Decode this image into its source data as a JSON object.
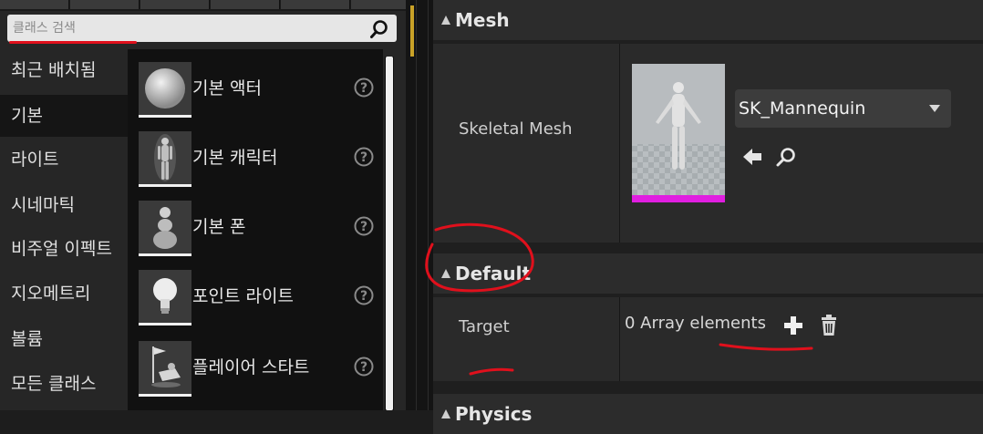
{
  "placement": {
    "search": {
      "placeholder": "클래스 검색",
      "value": ""
    },
    "categories": [
      {
        "label": "최근 배치됨",
        "selected": false
      },
      {
        "label": "기본",
        "selected": true
      },
      {
        "label": "라이트",
        "selected": false
      },
      {
        "label": "시네마틱",
        "selected": false
      },
      {
        "label": "비주얼 이펙트",
        "selected": false
      },
      {
        "label": "지오메트리",
        "selected": false
      },
      {
        "label": "볼륨",
        "selected": false
      },
      {
        "label": "모든 클래스",
        "selected": false
      }
    ],
    "items": [
      {
        "label": "기본 액터",
        "icon": "sphere-icon"
      },
      {
        "label": "기본 캐릭터",
        "icon": "character-icon"
      },
      {
        "label": "기본 폰",
        "icon": "pawn-icon"
      },
      {
        "label": "포인트 라이트",
        "icon": "lightbulb-icon"
      },
      {
        "label": "플레이어 스타트",
        "icon": "player-start-icon"
      }
    ]
  },
  "details": {
    "mesh_section": {
      "title": "Mesh",
      "skeletal_mesh": {
        "name": "Skeletal Mesh",
        "value": "SK_Mannequin"
      }
    },
    "default_section": {
      "title": "Default",
      "target": {
        "name": "Target",
        "value": "0 Array elements"
      }
    },
    "physics_section": {
      "title": "Physics"
    }
  },
  "colors": {
    "accent": "#c9a227",
    "annotation": "#e0101c",
    "asset_type_bar": "#e01ee0"
  }
}
